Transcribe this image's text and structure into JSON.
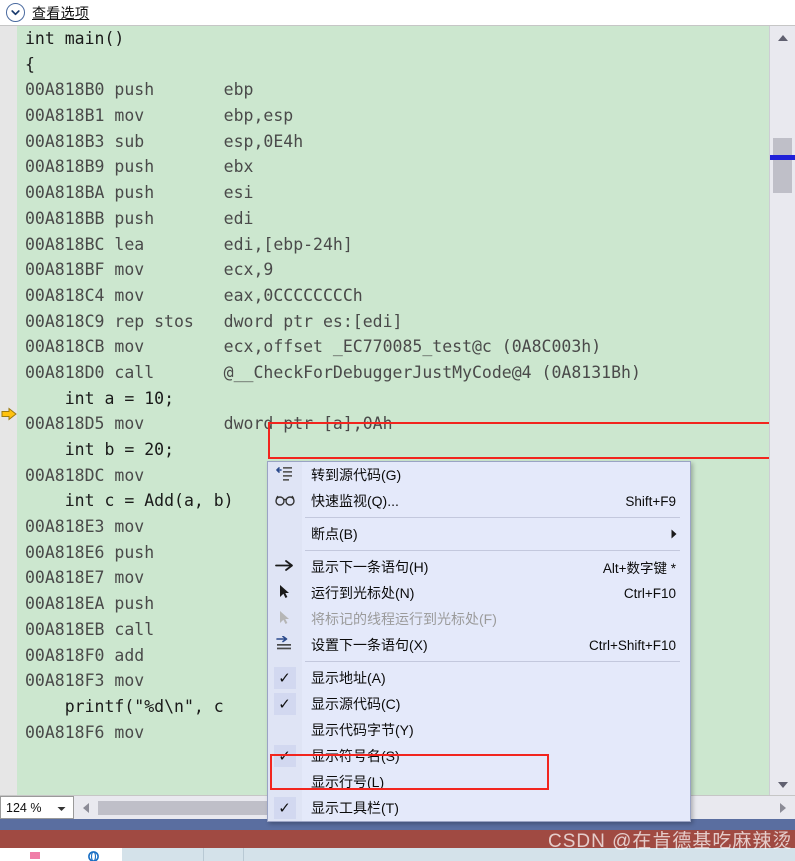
{
  "header": {
    "title": "查看选项",
    "chevron_icon": "chevron-down-icon"
  },
  "editor": {
    "background_color": "#cce7cf",
    "gutter_marker_icon": "instruction-pointer-arrow-icon",
    "lines": [
      {
        "kind": "source",
        "text": "int main()"
      },
      {
        "kind": "source",
        "text": "{"
      },
      {
        "kind": "asm",
        "address": "00A818B0",
        "mnemonic": "push",
        "operands": "ebp"
      },
      {
        "kind": "asm",
        "address": "00A818B1",
        "mnemonic": "mov",
        "operands": "ebp,esp"
      },
      {
        "kind": "asm",
        "address": "00A818B3",
        "mnemonic": "sub",
        "operands": "esp,0E4h"
      },
      {
        "kind": "asm",
        "address": "00A818B9",
        "mnemonic": "push",
        "operands": "ebx"
      },
      {
        "kind": "asm",
        "address": "00A818BA",
        "mnemonic": "push",
        "operands": "esi"
      },
      {
        "kind": "asm",
        "address": "00A818BB",
        "mnemonic": "push",
        "operands": "edi"
      },
      {
        "kind": "asm",
        "address": "00A818BC",
        "mnemonic": "lea",
        "operands": "edi,[ebp-24h]"
      },
      {
        "kind": "asm",
        "address": "00A818BF",
        "mnemonic": "mov",
        "operands": "ecx,9"
      },
      {
        "kind": "asm",
        "address": "00A818C4",
        "mnemonic": "mov",
        "operands": "eax,0CCCCCCCCh"
      },
      {
        "kind": "asm",
        "address": "00A818C9",
        "mnemonic": "rep stos",
        "operands": "dword ptr es:[edi]"
      },
      {
        "kind": "asm",
        "address": "00A818CB",
        "mnemonic": "mov",
        "operands": "ecx,offset _EC770085_test@c (0A8C003h)"
      },
      {
        "kind": "asm",
        "address": "00A818D0",
        "mnemonic": "call",
        "operands": "@__CheckForDebuggerJustMyCode@4 (0A8131Bh)"
      },
      {
        "kind": "source",
        "text": "    int a = 10;"
      },
      {
        "kind": "asm",
        "address": "00A818D5",
        "mnemonic": "mov",
        "operands": "dword ptr [a],0Ah"
      },
      {
        "kind": "source",
        "text": "    int b = 20;"
      },
      {
        "kind": "asm",
        "address": "00A818DC",
        "mnemonic": "mov",
        "operands": ""
      },
      {
        "kind": "source",
        "text": "    int c = Add(a, b)"
      },
      {
        "kind": "asm",
        "address": "00A818E3",
        "mnemonic": "mov",
        "operands": ""
      },
      {
        "kind": "asm",
        "address": "00A818E6",
        "mnemonic": "push",
        "operands": ""
      },
      {
        "kind": "asm",
        "address": "00A818E7",
        "mnemonic": "mov",
        "operands": ""
      },
      {
        "kind": "asm",
        "address": "00A818EA",
        "mnemonic": "push",
        "operands": ""
      },
      {
        "kind": "asm",
        "address": "00A818EB",
        "mnemonic": "call",
        "operands": ""
      },
      {
        "kind": "asm",
        "address": "00A818F0",
        "mnemonic": "add",
        "operands": ""
      },
      {
        "kind": "asm",
        "address": "00A818F3",
        "mnemonic": "mov",
        "operands": ""
      },
      {
        "kind": "source",
        "text": "    printf(\"%d\\n\", c"
      },
      {
        "kind": "asm",
        "address": "00A818F6",
        "mnemonic": "mov",
        "operands": ""
      }
    ],
    "highlights": [
      {
        "name": "call-line-highlight",
        "color": "#f2251e"
      },
      {
        "name": "show-symbol-names-highlight",
        "color": "#f2251e"
      }
    ]
  },
  "scrollbars": {
    "vertical": {
      "up_icon": "scroll-up-arrow-icon",
      "down_icon": "scroll-down-arrow-icon"
    },
    "horizontal": {
      "left_icon": "scroll-left-arrow-icon",
      "right_icon": "scroll-right-arrow-icon"
    }
  },
  "zoom_control": {
    "value": "124 %",
    "dropdown_icon": "chevron-down-icon"
  },
  "context_menu": {
    "items": [
      {
        "type": "item",
        "icon": "goto-source-icon",
        "label": "转到源代码(G)",
        "accel": "",
        "disabled": false
      },
      {
        "type": "item",
        "icon": "quickwatch-glasses-icon",
        "label": "快速监视(Q)...",
        "accel": "Shift+F9",
        "disabled": false
      },
      {
        "type": "separator"
      },
      {
        "type": "submenu",
        "icon": "",
        "label": "断点(B)",
        "accel": "",
        "disabled": false,
        "arrow_icon": "submenu-arrow-icon"
      },
      {
        "type": "separator"
      },
      {
        "type": "item",
        "icon": "show-next-statement-arrow-icon",
        "label": "显示下一条语句(H)",
        "accel": "Alt+数字键 *",
        "disabled": false
      },
      {
        "type": "item",
        "icon": "run-to-cursor-icon",
        "label": "运行到光标处(N)",
        "accel": "Ctrl+F10",
        "disabled": false
      },
      {
        "type": "item",
        "icon": "run-flagged-threads-to-cursor-icon",
        "label": "将标记的线程运行到光标处(F)",
        "accel": "",
        "disabled": true
      },
      {
        "type": "item",
        "icon": "set-next-statement-icon",
        "label": "设置下一条语句(X)",
        "accel": "Ctrl+Shift+F10",
        "disabled": false
      },
      {
        "type": "separator"
      },
      {
        "type": "check",
        "checked": true,
        "label": "显示地址(A)",
        "accel": "",
        "disabled": false
      },
      {
        "type": "check",
        "checked": true,
        "label": "显示源代码(C)",
        "accel": "",
        "disabled": false
      },
      {
        "type": "check",
        "checked": false,
        "label": "显示代码字节(Y)",
        "accel": "",
        "disabled": false
      },
      {
        "type": "check",
        "checked": true,
        "label": "显示符号名(S)",
        "accel": "",
        "disabled": false
      },
      {
        "type": "check",
        "checked": false,
        "label": "显示行号(L)",
        "accel": "",
        "disabled": false
      },
      {
        "type": "check",
        "checked": true,
        "label": "显示工具栏(T)",
        "accel": "",
        "disabled": false
      }
    ]
  },
  "watermark": {
    "text": "CSDN @在肯德基吃麻辣烫"
  }
}
